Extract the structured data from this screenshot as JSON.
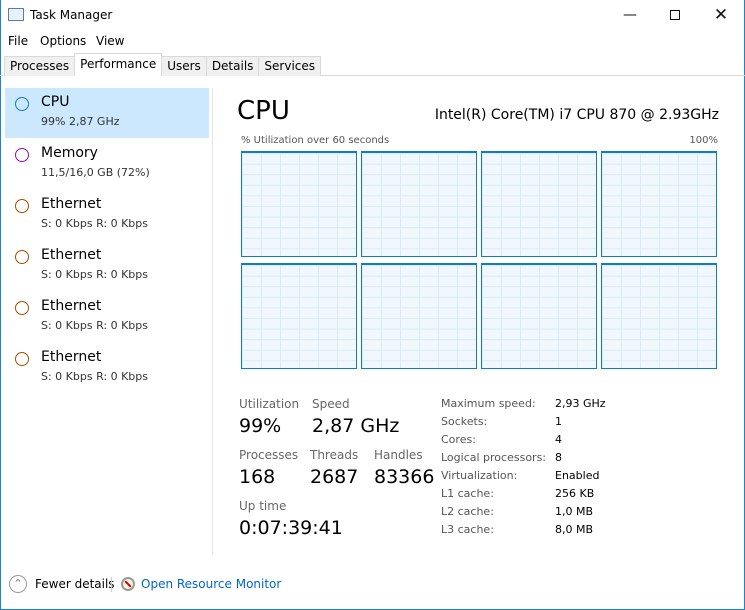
{
  "window": {
    "title": "Task Manager",
    "icon": "task-manager-icon"
  },
  "menu": [
    "File",
    "Options",
    "View"
  ],
  "tabs": [
    {
      "label": "Processes"
    },
    {
      "label": "Performance",
      "active": true
    },
    {
      "label": "Users"
    },
    {
      "label": "Details"
    },
    {
      "label": "Services"
    }
  ],
  "sidebar": {
    "items": [
      {
        "name": "CPU",
        "sub": "99%  2,87 GHz",
        "color": "#117dbb",
        "selected": true
      },
      {
        "name": "Memory",
        "sub": "11,5/16,0 GB (72%)",
        "color": "#8b12ae"
      },
      {
        "name": "Ethernet",
        "sub": "S: 0 Kbps  R: 0 Kbps",
        "color": "#a74f01"
      },
      {
        "name": "Ethernet",
        "sub": "S: 0 Kbps  R: 0 Kbps",
        "color": "#a74f01"
      },
      {
        "name": "Ethernet",
        "sub": "S: 0 Kbps  R: 0 Kbps",
        "color": "#a74f01"
      },
      {
        "name": "Ethernet",
        "sub": "S: 0 Kbps  R: 0 Kbps",
        "color": "#a74f01"
      }
    ]
  },
  "main": {
    "title": "CPU",
    "model": "Intel(R) Core(TM) i7 CPU 870 @ 2.93GHz",
    "graph_label": "% Utilization over 60 seconds",
    "graph_max": "100%",
    "core_count_graphs": 8,
    "stats": {
      "utilization_label": "Utilization",
      "utilization": "99%",
      "speed_label": "Speed",
      "speed": "2,87 GHz",
      "processes_label": "Processes",
      "processes": "168",
      "threads_label": "Threads",
      "threads": "2687",
      "handles_label": "Handles",
      "handles": "83366",
      "uptime_label": "Up time",
      "uptime": "0:07:39:41"
    },
    "details": [
      {
        "label": "Maximum speed:",
        "value": "2,93 GHz"
      },
      {
        "label": "Sockets:",
        "value": "1"
      },
      {
        "label": "Cores:",
        "value": "4"
      },
      {
        "label": "Logical processors:",
        "value": "8"
      },
      {
        "label": "Virtualization:",
        "value": "Enabled"
      },
      {
        "label": "L1 cache:",
        "value": "256 KB"
      },
      {
        "label": "L2 cache:",
        "value": "1,0 MB"
      },
      {
        "label": "L3 cache:",
        "value": "8,0 MB"
      }
    ]
  },
  "footer": {
    "fewer_details": "Fewer details",
    "resource_monitor": "Open Resource Monitor",
    "link_color": "#0066cc"
  }
}
